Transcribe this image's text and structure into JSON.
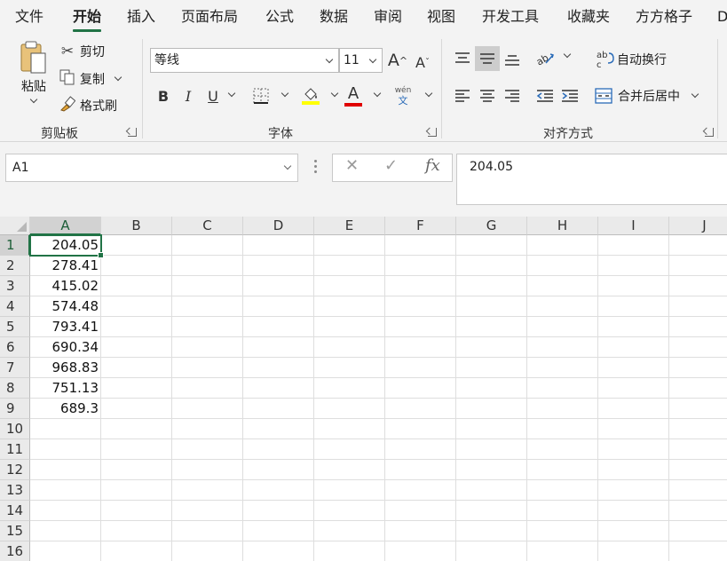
{
  "tabs": [
    "文件",
    "开始",
    "插入",
    "页面布局",
    "公式",
    "数据",
    "审阅",
    "视图",
    "开发工具",
    "收藏夹",
    "方方格子",
    "D"
  ],
  "active_tab": "开始",
  "clipboard": {
    "paste": "粘贴",
    "cut": "剪切",
    "copy": "复制",
    "format_painter": "格式刷",
    "label": "剪贴板"
  },
  "font": {
    "family": "等线",
    "size": "11",
    "grow": "A",
    "shrink": "A",
    "bold": "B",
    "italic": "I",
    "underline": "U",
    "font_color_glyph": "A",
    "phonetic_top": "wén",
    "phonetic_bottom": "文",
    "label": "字体",
    "highlight_color": "#ffff00",
    "font_color": "#e00000"
  },
  "alignment": {
    "wrap_text": "自动换行",
    "merge_center": "合并后居中",
    "label": "对齐方式"
  },
  "formula_bar": {
    "name_box": "A1",
    "fx": "fx",
    "cancel": "✕",
    "enter": "✓",
    "content": "204.05"
  },
  "sheet": {
    "columns": [
      "A",
      "B",
      "C",
      "D",
      "E",
      "F",
      "G",
      "H",
      "I",
      "J"
    ],
    "rows": [
      "1",
      "2",
      "3",
      "4",
      "5",
      "6",
      "7",
      "8",
      "9",
      "10",
      "11",
      "12",
      "13",
      "14",
      "15",
      "16"
    ],
    "column_a_values": [
      "204.05",
      "278.41",
      "415.02",
      "574.48",
      "793.41",
      "690.34",
      "968.83",
      "751.13",
      "689.3"
    ],
    "selected_cell": "A1"
  },
  "colors": {
    "accent": "#217346"
  }
}
